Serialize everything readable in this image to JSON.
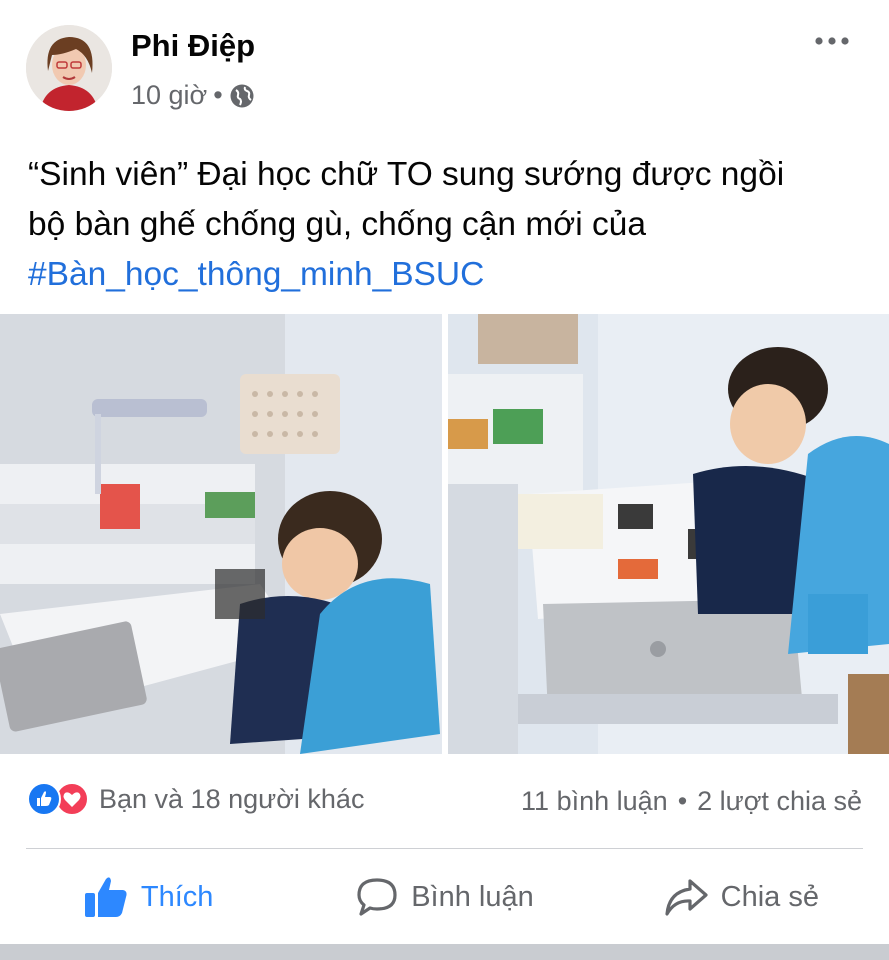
{
  "post": {
    "author": "Phi Điệp",
    "time": "10 giờ",
    "separator": "•",
    "privacy_icon": "globe-icon",
    "text_line1": "“Sinh viên” Đại học chữ TO sung sướng được ngồi",
    "text_line2": "bộ bàn ghế chống gù, chống cận mới của",
    "hashtag": "#Bàn_học_thông_minh_BSUC"
  },
  "stats": {
    "reactions_text": "Bạn và 18 người khác",
    "comments": "11 bình luận",
    "shares": "2 lượt chia sẻ",
    "separator": "•"
  },
  "actions": {
    "like": "Thích",
    "comment": "Bình luận",
    "share": "Chia sẻ"
  },
  "colors": {
    "like_blue": "#2d88ff",
    "hashtag_blue": "#216fdb",
    "love_red": "#f33e58",
    "muted_text": "#65676b"
  }
}
